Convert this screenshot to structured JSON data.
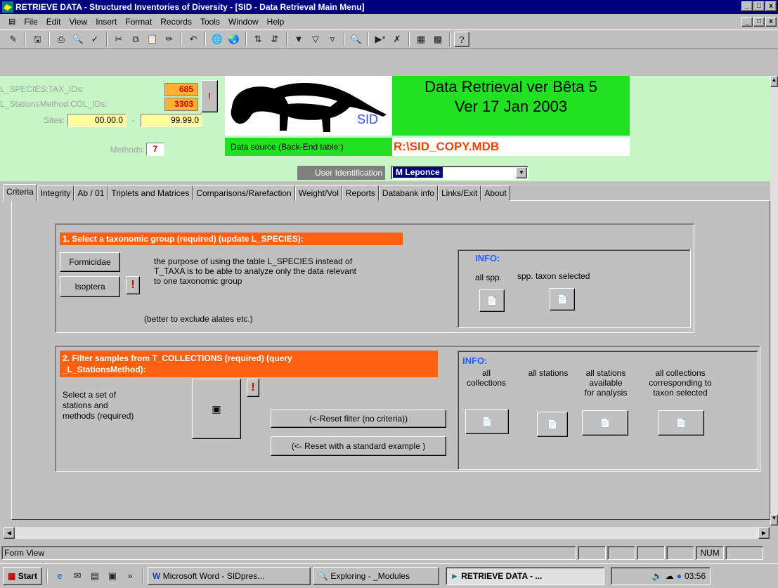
{
  "window": {
    "title": "RETRIEVE DATA - Structured Inventories of Diversity - [SID - Data Retrieval Main Menu]",
    "controls": [
      "_",
      "□",
      "x"
    ]
  },
  "menu": {
    "items": [
      "File",
      "Edit",
      "View",
      "Insert",
      "Format",
      "Records",
      "Tools",
      "Window",
      "Help"
    ],
    "mdi_controls": [
      "_",
      "□",
      "x"
    ]
  },
  "toolbar": {
    "icons": [
      "design-view",
      "save",
      "print",
      "print-preview",
      "spelling",
      "cut",
      "copy",
      "paste",
      "format-painter",
      "undo",
      "insert-hyperlink",
      "web-toolbar",
      "sort-ascending",
      "sort-descending",
      "filter-by-selection",
      "filter-by-form",
      "apply-filter",
      "find",
      "new-record",
      "delete-record",
      "database-window",
      "new-object",
      "help"
    ]
  },
  "header": {
    "labels": {
      "species": "L_SPECIES:TAX_IDs:",
      "stations": "L_StationsMethod:COL_IDs:",
      "sites": "Sites:",
      "methods": "Methods:"
    },
    "values": {
      "species_count": "685",
      "stations_count": "3303",
      "site_from": "00.00.0",
      "site_to": "99.99.0",
      "methods": "7"
    },
    "site_separator": "-",
    "logo_text": "SID",
    "title_line1": "Data Retrieval ver Bêta 5",
    "title_line2": "Ver 17 Jan 2003",
    "datasource_label": "Data source (Back-End table:)",
    "datasource_value": "R:\\SID_COPY.MDB",
    "user_label": "User Identification",
    "user_value": "M Leponce"
  },
  "tabs": [
    "Criteria",
    "Integrity",
    "Ab / 01",
    "Triplets and Matrices",
    "Comparisons/Rarefaction",
    "Weight/Vol",
    "Reports",
    "Databank info",
    "Links/Exit",
    "About"
  ],
  "section1": {
    "heading": "1. Select a taxonomic group (required) (update L_SPECIES):",
    "btn_formicidae": "Formicidae",
    "btn_isoptera": "Isoptera",
    "desc_line1": "the purpose of using the table L_SPECIES instead of",
    "desc_line2": "T_TAXA is to be able to analyze only the data relevant",
    "desc_line3": "to one taxonomic group",
    "note": "(better to exclude alates etc.)",
    "info_title": "INFO:",
    "info_all": "all spp.",
    "info_taxon": "spp. taxon selected"
  },
  "section2": {
    "heading_line1": "2. Filter samples from T_COLLECTIONS  (required) (query",
    "heading_line2": "_L_StationsMethod):",
    "select_line1": "Select a set of",
    "select_line2": "stations and",
    "select_line3": "methods (required)",
    "btn_reset": "(<-Reset filter (no criteria))",
    "btn_reset_example": "(<- Reset with a standard example )",
    "info_title": "INFO:",
    "col1_line1": "all",
    "col1_line2": "collections",
    "col2_line1": "all stations",
    "col3_line1": "all stations",
    "col3_line2": "available",
    "col3_line3": "for analysis",
    "col4_line1": "all collections",
    "col4_line2": "corresponding to",
    "col4_line3": "taxon selected"
  },
  "status": {
    "left": "Form View",
    "num": "NUM"
  },
  "taskbar": {
    "start": "Start",
    "tasks": [
      "Microsoft Word - SIDpres...",
      "Exploring - _Modules",
      "RETRIEVE DATA - ..."
    ],
    "time": "03:56"
  }
}
